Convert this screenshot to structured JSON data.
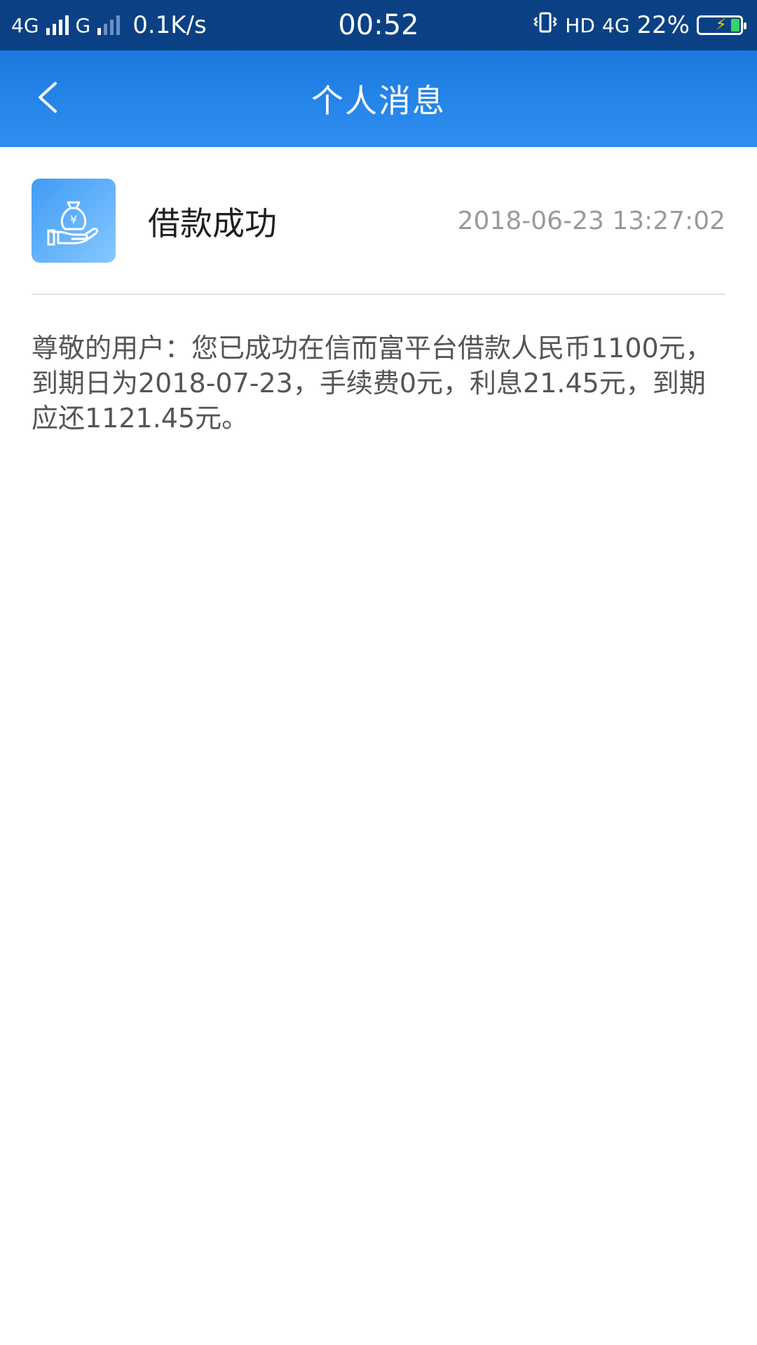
{
  "status_bar": {
    "network1": "4G",
    "network2": "G",
    "speed": "0.1K/s",
    "time": "00:52",
    "hd": "HD",
    "network3": "4G",
    "battery_percent": "22%",
    "battery_level": 0.22,
    "icons": [
      "vibrate-icon",
      "signal-icon",
      "battery-charging-icon"
    ]
  },
  "header": {
    "title": "个人消息",
    "back_icon": "chevron-left-icon"
  },
  "message": {
    "icon": "money-bag-hand-icon",
    "title": "借款成功",
    "timestamp": "2018-06-23 13:27:02",
    "body": "尊敬的用户：您已成功在信而富平台借款人民币1100元，到期日为2018-07-23，手续费0元，利息21.45元，到期应还1121.45元。"
  },
  "colors": {
    "status_bar": "#0b4184",
    "app_bar": "#2e8ff0",
    "icon_bg": "#5aaefa"
  }
}
